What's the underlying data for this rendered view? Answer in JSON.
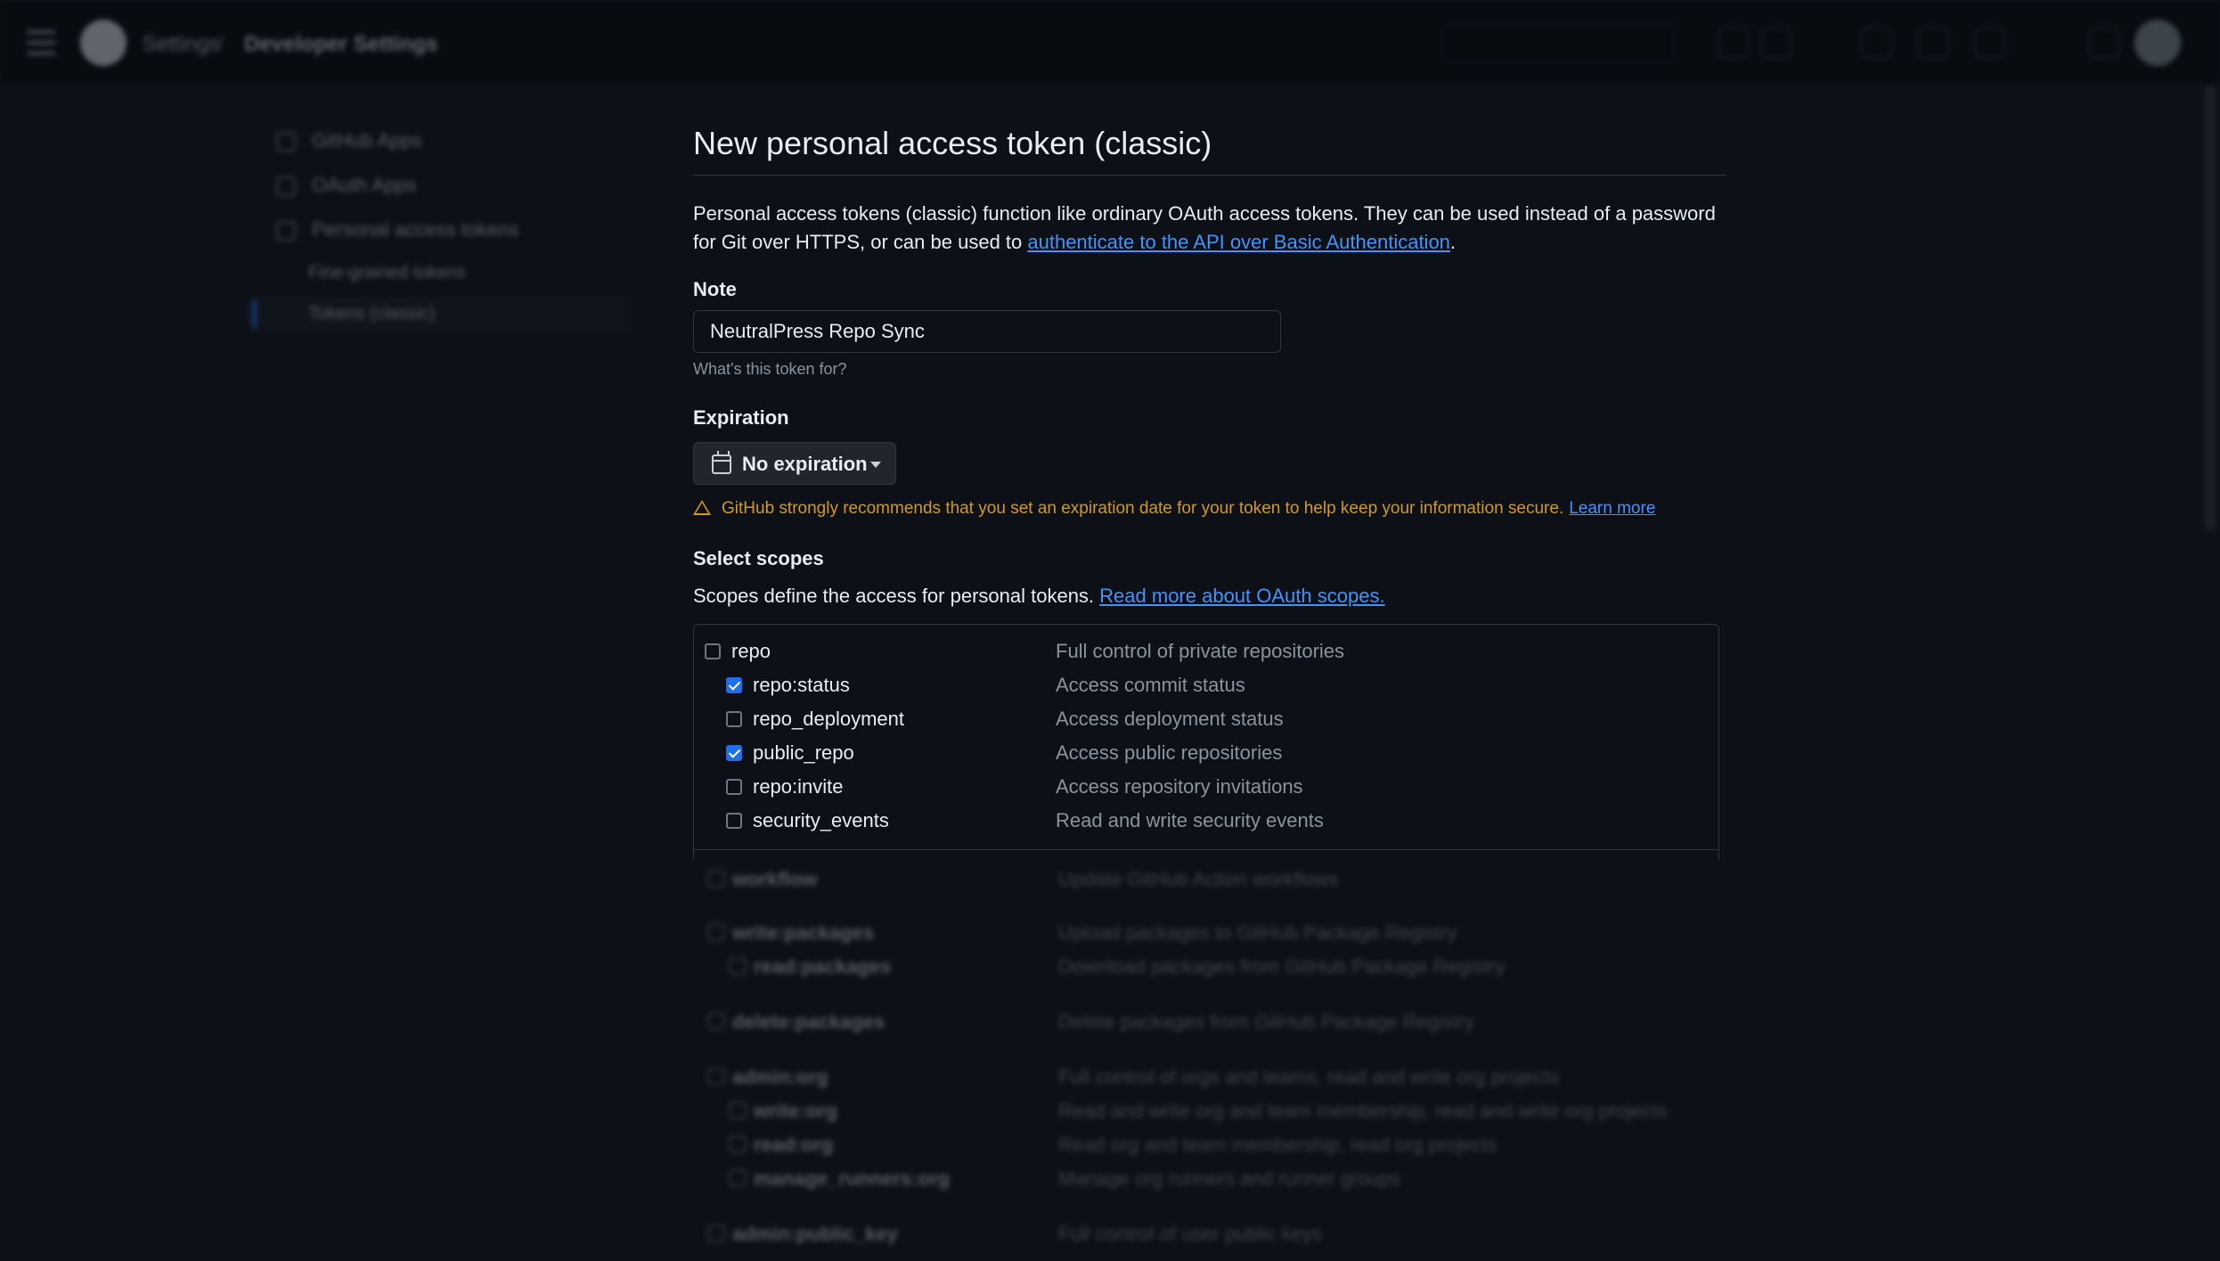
{
  "header": {
    "breadcrumb_root": "Settings",
    "breadcrumb_separator": "/",
    "breadcrumb_current": "Developer Settings"
  },
  "sidebar": {
    "items": [
      {
        "label": "GitHub Apps"
      },
      {
        "label": "OAuth Apps"
      },
      {
        "label": "Personal access tokens"
      },
      {
        "label": "Fine-grained tokens"
      },
      {
        "label": "Tokens (classic)"
      }
    ]
  },
  "form": {
    "title": "New personal access token (classic)",
    "intro_text": "Personal access tokens (classic) function like ordinary OAuth access tokens. They can be used instead of a password for Git over HTTPS, or can be used to ",
    "intro_link": "authenticate to the API over Basic Authentication",
    "intro_end": ".",
    "note_label": "Note",
    "note_value": "NeutralPress Repo Sync",
    "note_hint": "What's this token for?",
    "expiration_label": "Expiration",
    "expiration_value": "No expiration",
    "warning_text": "GitHub strongly recommends that you set an expiration date for your token to help keep your information secure.",
    "warning_link": "Learn more",
    "scopes_label": "Select scopes",
    "scopes_desc": "Scopes define the access for personal tokens. ",
    "scopes_link": "Read more about OAuth scopes.",
    "scopes": [
      {
        "name": "repo",
        "description": "Full control of private repositories",
        "checked": false,
        "child": false
      },
      {
        "name": "repo:status",
        "description": "Access commit status",
        "checked": true,
        "child": true
      },
      {
        "name": "repo_deployment",
        "description": "Access deployment status",
        "checked": false,
        "child": true
      },
      {
        "name": "public_repo",
        "description": "Access public repositories",
        "checked": true,
        "child": true
      },
      {
        "name": "repo:invite",
        "description": "Access repository invitations",
        "checked": false,
        "child": true
      },
      {
        "name": "security_events",
        "description": "Read and write security events",
        "checked": false,
        "child": true
      }
    ]
  },
  "background_scopes": [
    {
      "name": "workflow",
      "description": "Update GitHub Action workflows",
      "child": false
    },
    {
      "name": "write:packages",
      "description": "Upload packages to GitHub Package Registry",
      "child": false
    },
    {
      "name": "read:packages",
      "description": "Download packages from GitHub Package Registry",
      "child": true
    },
    {
      "name": "delete:packages",
      "description": "Delete packages from GitHub Package Registry",
      "child": false
    },
    {
      "name": "admin:org",
      "description": "Full control of orgs and teams, read and write org projects",
      "child": false
    },
    {
      "name": "write:org",
      "description": "Read and write org and team membership, read and write org projects",
      "child": true
    },
    {
      "name": "read:org",
      "description": "Read org and team membership, read org projects",
      "child": true
    },
    {
      "name": "manage_runners:org",
      "description": "Manage org runners and runner groups",
      "child": true
    },
    {
      "name": "admin:public_key",
      "description": "Full control of user public keys",
      "child": false
    }
  ],
  "colors": {
    "accent": "#1f6feb",
    "link": "#4493f8",
    "warning": "#d29922",
    "background": "#0d1117"
  }
}
